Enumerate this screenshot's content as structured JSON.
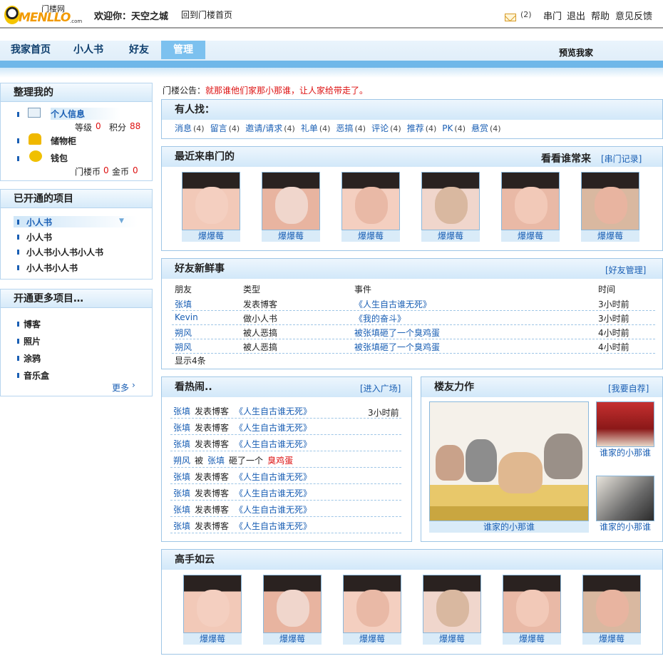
{
  "topbar": {
    "logo_text": "门楼网",
    "logo_word": "MENLLO",
    "logo_domain": ".com",
    "welcome": "欢迎你：天空之城",
    "home_link": "回到门楼首页",
    "mail_count": "(2)",
    "links": [
      "串门",
      "退出",
      "帮助",
      "意见反馈"
    ]
  },
  "nav": {
    "tabs": [
      "我家首页",
      "小人书",
      "好友",
      "管理"
    ],
    "active_tab": "管理",
    "preview": "预览我家"
  },
  "sidebar": {
    "organize": {
      "title": "整理我的",
      "items": [
        {
          "label": "个人信息",
          "icon": "id-card-icon"
        },
        {
          "label": "储物柜",
          "icon": "cabinet-icon"
        },
        {
          "label": "钱包",
          "icon": "wallet-icon"
        }
      ],
      "level_label": "等级",
      "level_value": "0",
      "points_label": "积分",
      "points_value": "88",
      "coin_label": "门楼币",
      "coin_value": "0",
      "gold_label": "金币",
      "gold_value": "0"
    },
    "opened": {
      "title": "已开通的项目",
      "items": [
        "小人书",
        "小人书",
        "小人书小人书小人书",
        "小人书小人书"
      ]
    },
    "more": {
      "title": "开通更多项目…",
      "items": [
        "博客",
        "照片",
        "涂鸦",
        "音乐盒"
      ],
      "more_link": "更多"
    }
  },
  "notice": {
    "label": "门楼公告：",
    "text": "就那谁他们家那小那谁，让人家给带走了。"
  },
  "finder": {
    "title": "有人找：",
    "items": [
      {
        "label": "消息",
        "count": "(4)"
      },
      {
        "label": "留言",
        "count": "(4)"
      },
      {
        "label": "邀请/请求",
        "count": "(4)"
      },
      {
        "label": "礼单",
        "count": "(4)"
      },
      {
        "label": "恶搞",
        "count": "(4)"
      },
      {
        "label": "评论",
        "count": "(4)"
      },
      {
        "label": "推荐",
        "count": "(4)"
      },
      {
        "label": "PK",
        "count": "(4)"
      },
      {
        "label": "悬赏",
        "count": "(4)"
      }
    ]
  },
  "recent": {
    "title": "最近来串门的",
    "right_title": "看看谁常来",
    "right_link": "[串门记录]",
    "people": [
      "爆爆莓",
      "爆爆莓",
      "爆爆莓",
      "爆爆莓",
      "爆爆莓",
      "爆爆莓"
    ]
  },
  "news": {
    "title": "好友新鲜事",
    "manage": "[好友管理]",
    "columns": [
      "朋友",
      "类型",
      "事件",
      "时间"
    ],
    "rows": [
      {
        "friend": "张填",
        "type": "发表博客",
        "event": "《人生自古谁无死》",
        "time": "3小时前"
      },
      {
        "friend": "Kevin",
        "type": "做小人书",
        "event": "《我的奋斗》",
        "time": "3小时前"
      },
      {
        "friend": "朔风",
        "type": "被人恶搞",
        "event": "被张填砸了一个臭鸡蛋",
        "time": "4小时前"
      },
      {
        "friend": "朔风",
        "type": "被人恶搞",
        "event": "被张填砸了一个臭鸡蛋",
        "time": "4小时前"
      }
    ],
    "footer": "显示4条"
  },
  "hot": {
    "title": "看热闹..",
    "link": "[进入广场]",
    "time": "3小时前",
    "rows": [
      {
        "who": "张填",
        "verb": "发表博客",
        "obj": "《人生自古谁无死》"
      },
      {
        "who": "张填",
        "verb": "发表博客",
        "obj": "《人生自古谁无死》"
      },
      {
        "who": "张填",
        "verb": "发表博客",
        "obj": "《人生自古谁无死》"
      },
      {
        "who": "朔风",
        "verb": "被",
        "who2": "张填",
        "verb2": "砸了一个",
        "obj": "臭鸡蛋"
      },
      {
        "who": "张填",
        "verb": "发表博客",
        "obj": "《人生自古谁无死》"
      },
      {
        "who": "张填",
        "verb": "发表博客",
        "obj": "《人生自古谁无死》"
      },
      {
        "who": "张填",
        "verb": "发表博客",
        "obj": "《人生自古谁无死》"
      },
      {
        "who": "张填",
        "verb": "发表博客",
        "obj": "《人生自古谁无死》"
      }
    ]
  },
  "works": {
    "title": "楼友力作",
    "link": "[我要自荐]",
    "main_caption": "谁家的小那谁",
    "side_captions": [
      "谁家的小那谁",
      "谁家的小那谁"
    ]
  },
  "masters": {
    "title": "高手如云",
    "people": [
      "爆爆莓",
      "爆爆莓",
      "爆爆莓",
      "爆爆莓",
      "爆爆莓",
      "爆爆莓"
    ]
  },
  "colors": {
    "accent": "#1a5fb4",
    "nav_bar": "#6fb7e9",
    "active_tab": "#7cc1ef",
    "alert": "#dd1111"
  }
}
